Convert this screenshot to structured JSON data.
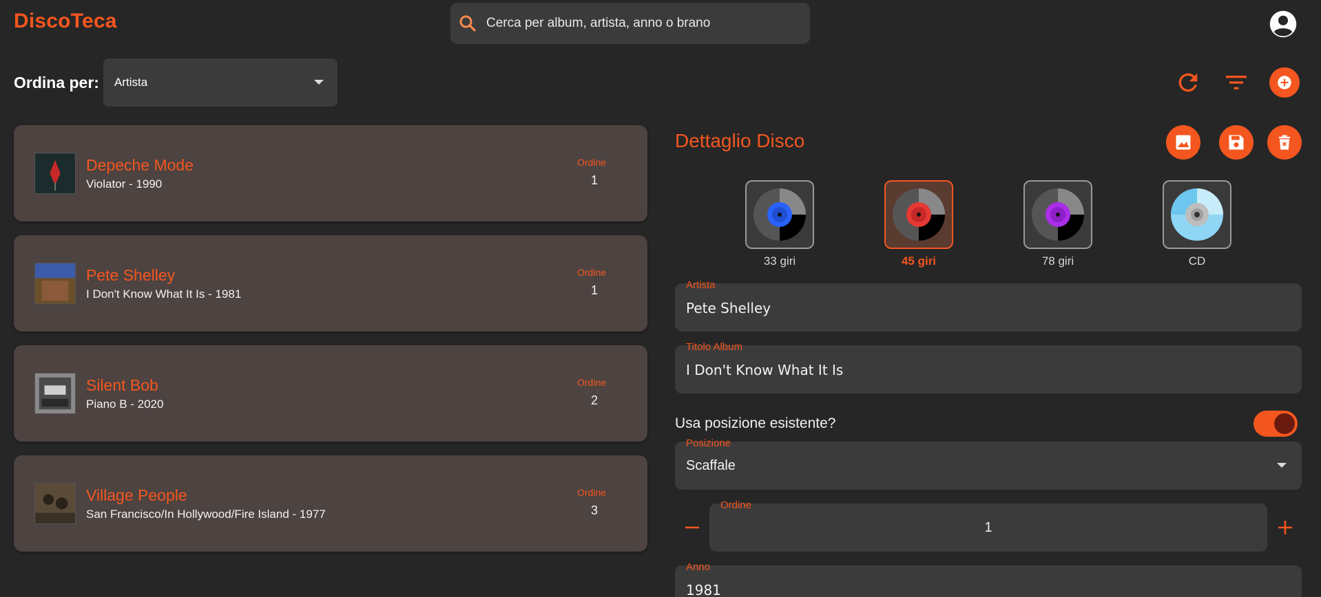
{
  "app": {
    "title": "DiscoTeca"
  },
  "search": {
    "placeholder": "Cerca per album, artista, anno o brano"
  },
  "sort": {
    "label": "Ordina per:",
    "selected": "Artista"
  },
  "list": {
    "order_label": "Ordine",
    "items": [
      {
        "artist": "Depeche Mode",
        "subtitle": "Violator - 1990",
        "order": "1",
        "cover_colors": [
          "#1a2a2a",
          "#c62828"
        ]
      },
      {
        "artist": "Pete Shelley",
        "subtitle": "I Don't Know What It Is - 1981",
        "order": "1",
        "cover_colors": [
          "#6b4f2a",
          "#3b5ba8"
        ]
      },
      {
        "artist": "Silent Bob",
        "subtitle": "Piano B - 2020",
        "order": "2",
        "cover_colors": [
          "#777777",
          "#333333"
        ]
      },
      {
        "artist": "Village People",
        "subtitle": "San Francisco/In Hollywood/Fire Island - 1977",
        "order": "3",
        "cover_colors": [
          "#5a4a38",
          "#2a2218"
        ]
      }
    ]
  },
  "detail": {
    "title": "Dettaglio Disco",
    "formats": [
      {
        "label": "33 giri",
        "color": "#2962ff",
        "selected": false
      },
      {
        "label": "45 giri",
        "color": "#e53935",
        "selected": true
      },
      {
        "label": "78 giri",
        "color": "#aa2ee8",
        "selected": false
      },
      {
        "label": "CD",
        "color": "#8fd6f5",
        "selected": false
      }
    ],
    "artist_label": "Artista",
    "artist_value": "Pete Shelley",
    "album_label": "Titolo Album",
    "album_value": "I Don't Know What It Is",
    "toggle_label": "Usa posizione esistente?",
    "toggle_on": true,
    "position_label": "Posizione",
    "position_value": "Scaffale",
    "order_label": "Ordine",
    "order_value": "1",
    "year_label": "Anno",
    "year_value": "1981"
  },
  "colors": {
    "accent": "#f4561f",
    "background": "#262626",
    "card": "#4d4341",
    "field": "#3b3b3b"
  },
  "icons": [
    "search-icon",
    "account-icon",
    "refresh-icon",
    "filter-icon",
    "add-icon",
    "image-icon",
    "save-icon",
    "delete-icon",
    "vinyl-icon",
    "cd-icon",
    "minus-icon",
    "plus-icon",
    "chevron-down-icon"
  ]
}
